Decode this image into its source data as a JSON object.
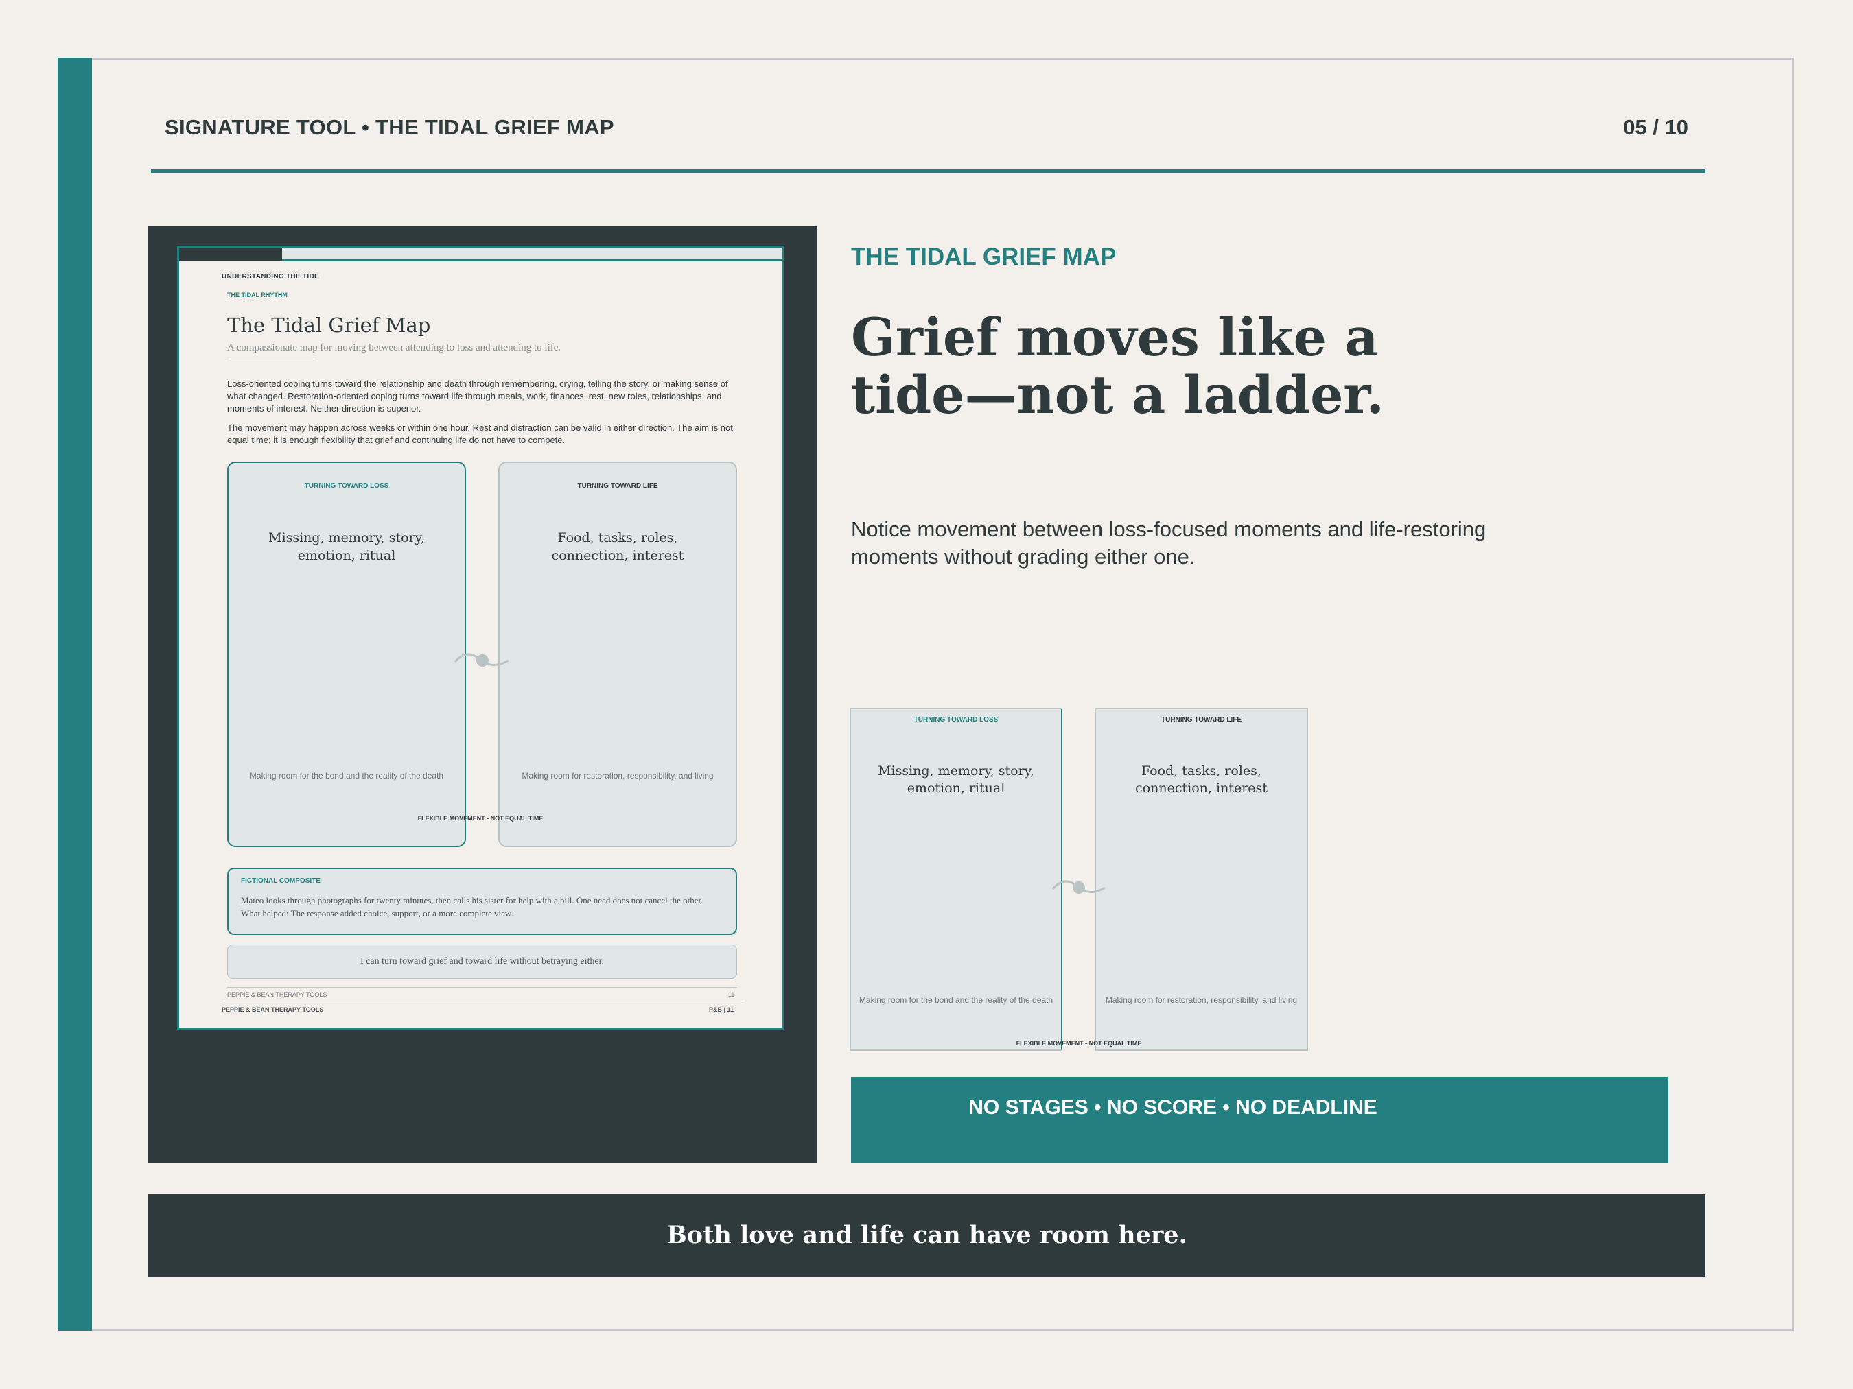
{
  "colors": {
    "accent": "#237f80",
    "dark": "#2e3a3c",
    "background": "#f3efea",
    "card": "#e0e7e6",
    "frame": "#c3c6cb",
    "white": "#ffffff"
  },
  "header": {
    "title": "SIGNATURE TOOL • THE TIDAL GRIEF MAP",
    "page": "05 / 10"
  },
  "preview": {
    "kicker": "UNDERSTANDING THE TIDE",
    "section": "THE TIDAL RHYTHM",
    "title": "The Tidal Grief Map",
    "subtitle": "A compassionate map for moving between attending to loss and attending to life.",
    "paragraph1": "Loss-oriented coping turns toward the relationship and death through remembering, crying, telling the story, or making sense of what changed. Restoration-oriented coping turns toward life through meals, work, finances, rest, new roles, relationships, and moments of interest. Neither direction is superior.",
    "paragraph2": "The movement may happen across weeks or within one hour. Rest and distraction can be valid in either direction. The aim is not equal time; it is enough flexibility that grief and continuing life do not have to compete.",
    "loss_card": {
      "label": "TURNING TOWARD LOSS",
      "main": "Missing, memory, story, emotion, ritual",
      "foot": "Making room for the bond and the reality of the death"
    },
    "life_card": {
      "label": "TURNING TOWARD LIFE",
      "main": "Food, tasks, roles, connection, interest",
      "foot": "Making room for restoration, responsibility, and living"
    },
    "flex_label": "FLEXIBLE MOVEMENT - NOT EQUAL TIME",
    "composite": {
      "label": "FICTIONAL COMPOSITE",
      "text": "Mateo looks through photographs for twenty minutes, then calls his sister for help with a bill. One need does not cancel the other. What helped: The response added choice, support, or a more complete view."
    },
    "affirmation": "I can turn toward grief and toward life without betraying either.",
    "footer_left": "PEPPIE & BEAN THERAPY TOOLS",
    "footer_right": "11",
    "brand_left": "PEPPIE & BEAN THERAPY TOOLS",
    "brand_right": "P&B  |  11"
  },
  "content": {
    "kicker": "THE TIDAL GRIEF MAP",
    "headline_line1": "Grief moves like a",
    "headline_line2": "tide—not a ladder.",
    "body": "Notice movement between loss-focused moments and life-restoring moments without grading either one."
  },
  "mini": {
    "loss_card": {
      "label": "TURNING TOWARD LOSS",
      "main": "Missing, memory, story, emotion, ritual",
      "foot": "Making room for the bond and the reality of the death"
    },
    "life_card": {
      "label": "TURNING TOWARD LIFE",
      "main": "Food, tasks, roles, connection, interest",
      "foot": "Making room for restoration, responsibility, and living"
    },
    "flex_label": "FLEXIBLE MOVEMENT - NOT EQUAL TIME"
  },
  "banner": {
    "text": "NO STAGES • NO SCORE • NO DEADLINE"
  },
  "footer": {
    "text": "Both love and life can have room here."
  },
  "icons": {
    "tide_wave": "wave-icon"
  }
}
